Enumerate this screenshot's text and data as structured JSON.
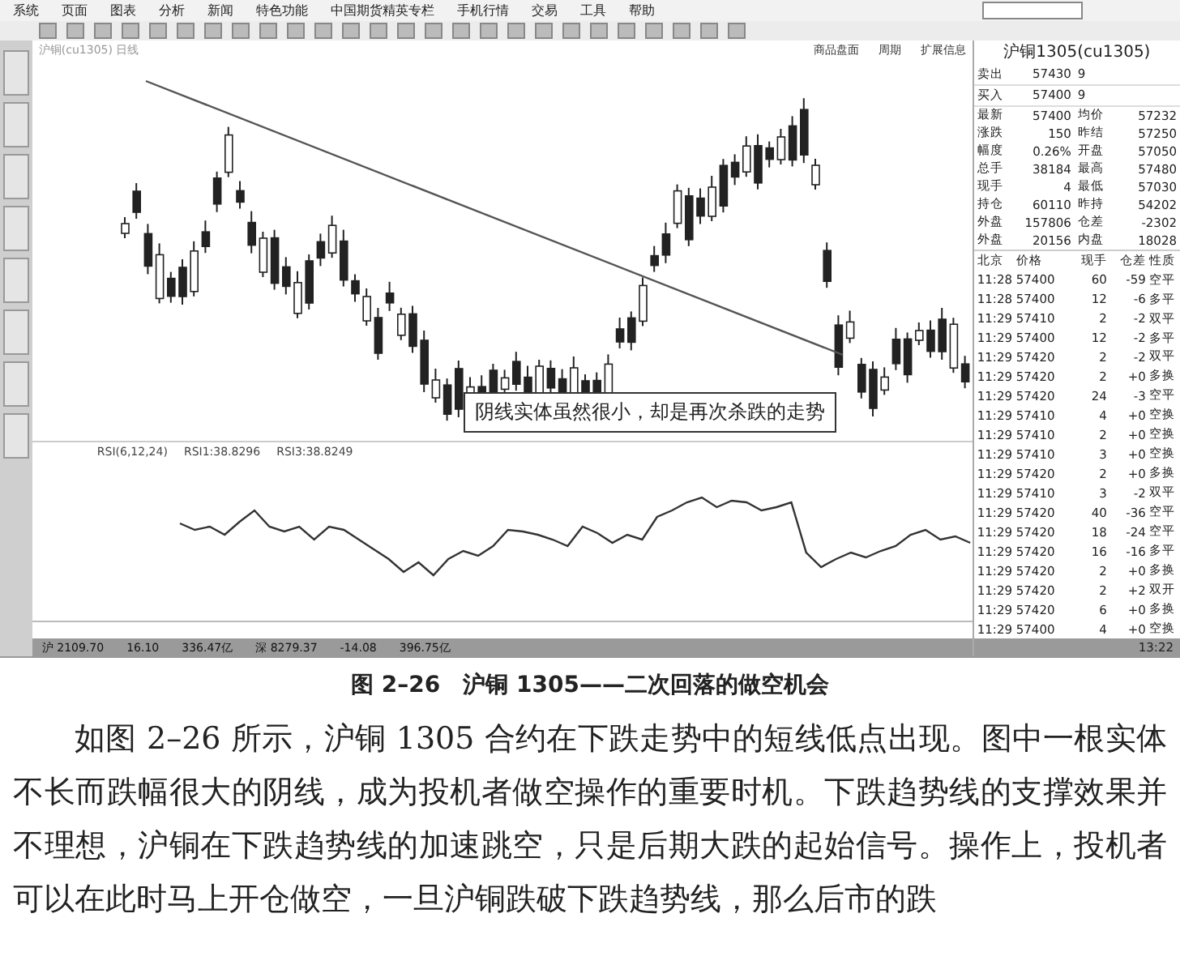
{
  "menu": [
    "系统",
    "页面",
    "图表",
    "分析",
    "新闻",
    "特色功能",
    "中国期货精英专栏",
    "手机行情",
    "交易",
    "工具",
    "帮助"
  ],
  "chart": {
    "title": "沪铜(cu1305) 日线",
    "header_tabs": [
      "商品盘面",
      "周期",
      "扩展信息"
    ],
    "annotation": "阴线实体虽然很小，却是再次杀跌的走势",
    "rsi_legend": [
      "RSI(6,12,24)",
      "RSI1:38.8296",
      "RSI3:38.8249"
    ]
  },
  "quote": {
    "title": "沪铜1305(cu1305)",
    "bid_ask": [
      {
        "label": "卖出",
        "price": "57430",
        "volume": "9"
      },
      {
        "label": "买入",
        "price": "57400",
        "volume": "9"
      }
    ],
    "stats": [
      {
        "label": "最新",
        "value": "57400",
        "label2": "均价",
        "value2": "57232"
      },
      {
        "label": "涨跌",
        "value": "150",
        "label2": "昨结",
        "value2": "57250"
      },
      {
        "label": "幅度",
        "value": "0.26%",
        "label2": "开盘",
        "value2": "57050"
      },
      {
        "label": "总手",
        "value": "38184",
        "label2": "最高",
        "value2": "57480"
      },
      {
        "label": "现手",
        "value": "4",
        "label2": "最低",
        "value2": "57030"
      },
      {
        "label": "持仓",
        "value": "60110",
        "label2": "昨持",
        "value2": "54202"
      },
      {
        "label": "外盘",
        "value": "157806",
        "label2": "仓差",
        "value2": "-2302"
      },
      {
        "label": "外盘",
        "value": "20156",
        "label2": "内盘",
        "value2": "18028"
      }
    ],
    "tick_columns": [
      "北京",
      "价格",
      "现手",
      "仓差",
      "性质"
    ],
    "ticks": [
      {
        "time": "11:28",
        "price": "57400",
        "volume": "60",
        "change": "-59",
        "nature": "空平"
      },
      {
        "time": "11:28",
        "price": "57400",
        "volume": "12",
        "change": "-6",
        "nature": "多平"
      },
      {
        "time": "11:29",
        "price": "57410",
        "volume": "2",
        "change": "-2",
        "nature": "双平"
      },
      {
        "time": "11:29",
        "price": "57400",
        "volume": "12",
        "change": "-2",
        "nature": "多平"
      },
      {
        "time": "11:29",
        "price": "57420",
        "volume": "2",
        "change": "-2",
        "nature": "双平"
      },
      {
        "time": "11:29",
        "price": "57420",
        "volume": "2",
        "change": "+0",
        "nature": "多换"
      },
      {
        "time": "11:29",
        "price": "57420",
        "volume": "24",
        "change": "-3",
        "nature": "空平"
      },
      {
        "time": "11:29",
        "price": "57410",
        "volume": "4",
        "change": "+0",
        "nature": "空换"
      },
      {
        "time": "11:29",
        "price": "57410",
        "volume": "2",
        "change": "+0",
        "nature": "空换"
      },
      {
        "time": "11:29",
        "price": "57410",
        "volume": "3",
        "change": "+0",
        "nature": "空换"
      },
      {
        "time": "11:29",
        "price": "57420",
        "volume": "2",
        "change": "+0",
        "nature": "多换"
      },
      {
        "time": "11:29",
        "price": "57410",
        "volume": "3",
        "change": "-2",
        "nature": "双平"
      },
      {
        "time": "11:29",
        "price": "57420",
        "volume": "40",
        "change": "-36",
        "nature": "空平"
      },
      {
        "time": "11:29",
        "price": "57420",
        "volume": "18",
        "change": "-24",
        "nature": "空平"
      },
      {
        "time": "11:29",
        "price": "57420",
        "volume": "16",
        "change": "-16",
        "nature": "多平"
      },
      {
        "time": "11:29",
        "price": "57420",
        "volume": "2",
        "change": "+0",
        "nature": "多换"
      },
      {
        "time": "11:29",
        "price": "57420",
        "volume": "2",
        "change": "+2",
        "nature": "双开"
      },
      {
        "time": "11:29",
        "price": "57420",
        "volume": "6",
        "change": "+0",
        "nature": "多换"
      },
      {
        "time": "11:29",
        "price": "57400",
        "volume": "4",
        "change": "+0",
        "nature": "空换"
      }
    ]
  },
  "status_bar": [
    "沪 2109.70",
    "16.10",
    "336.47亿",
    "深 8279.37",
    "-14.08",
    "396.75亿"
  ],
  "clock": "13:22",
  "caption": "图 2–26　沪铜 1305——二次回落的做空机会",
  "paragraph": "如图 2–26 所示，沪铜 1305 合约在下跌走势中的短线低点出现。图中一根实体不长而跌幅很大的阴线，成为投机者做空操作的重要时机。下跌趋势线的支撑效果并不理想，沪铜在下跌趋势线的加速跳空，只是后期大跌的起始信号。操作上，投机者可以在此时马上开仓做空，一旦沪铜跌破下跌趋势线，那么后市的跌"
}
